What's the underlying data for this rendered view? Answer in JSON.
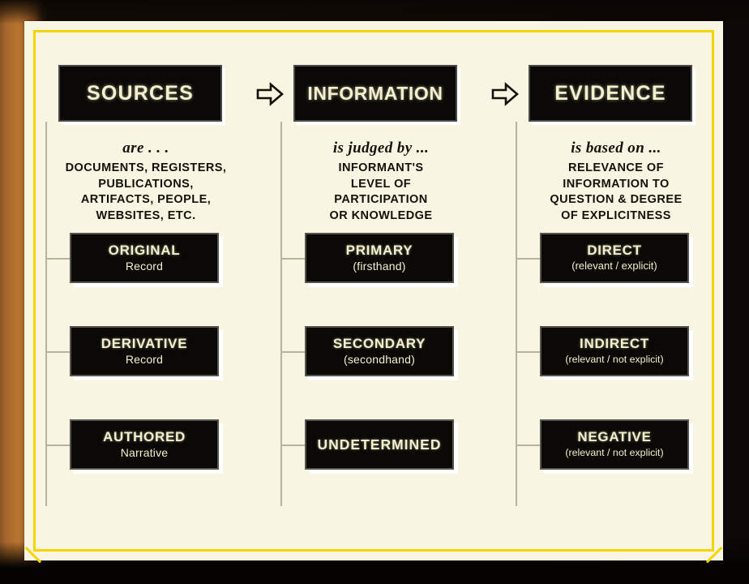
{
  "diagram": {
    "title": "Sources, Information, Evidence",
    "background_color": "#f8f6e2",
    "box_color": "#0a0906",
    "box_text_color": "#f4f0cd",
    "border_accent_color": "#f5d400",
    "connector_color": "#b7b49b",
    "flow_arrow_symbol": "block-right-arrow",
    "columns": [
      {
        "header": "SOURCES",
        "lead": "are . . .",
        "description_lines": [
          "DOCUMENTS,  REGISTERS,",
          "PUBLICATIONS,",
          "ARTIFACTS,  PEOPLE,",
          "WEBSITES,  ETC."
        ],
        "items": [
          {
            "title": "ORIGINAL",
            "subtitle": "Record"
          },
          {
            "title": "DERIVATIVE",
            "subtitle": "Record"
          },
          {
            "title": "AUTHORED",
            "subtitle": "Narrative"
          }
        ]
      },
      {
        "header": "INFORMATION",
        "lead": "is judged by ...",
        "description_lines": [
          "INFORMANT'S",
          "LEVEL  OF",
          "PARTICIPATION",
          "OR  KNOWLEDGE"
        ],
        "items": [
          {
            "title": "PRIMARY",
            "subtitle": "(firsthand)"
          },
          {
            "title": "SECONDARY",
            "subtitle": "(secondhand)"
          },
          {
            "title": "UNDETERMINED",
            "subtitle": ""
          }
        ]
      },
      {
        "header": "EVIDENCE",
        "lead": "is based on ...",
        "description_lines": [
          "RELEVANCE  OF",
          "INFORMATION TO",
          "QUESTION & DEGREE",
          "OF EXPLICITNESS"
        ],
        "items": [
          {
            "title": "DIRECT",
            "subtitle": "(relevant / explicit)"
          },
          {
            "title": "INDIRECT",
            "subtitle": "(relevant / not explicit)"
          },
          {
            "title": "NEGATIVE",
            "subtitle": "(relevant / not explicit)"
          }
        ]
      }
    ]
  }
}
